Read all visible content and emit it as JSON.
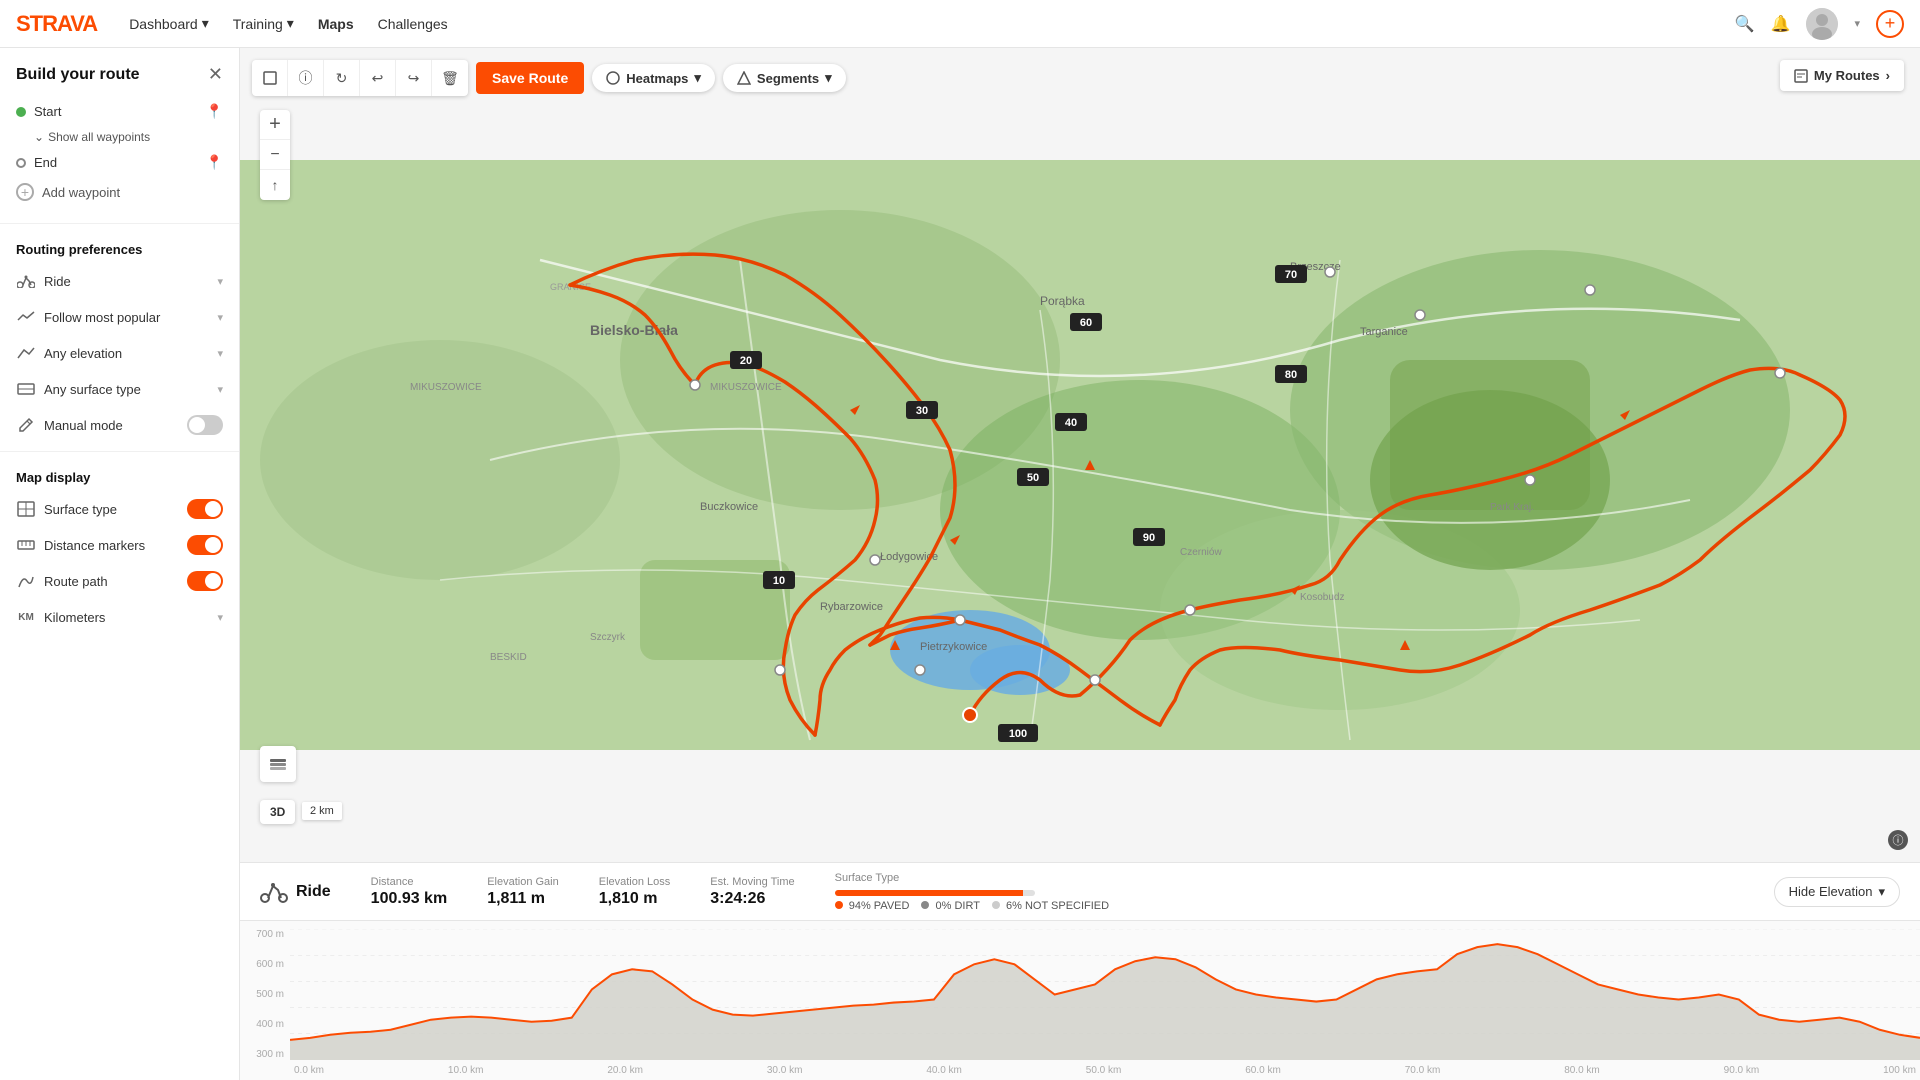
{
  "nav": {
    "logo": "STRAVA",
    "items": [
      {
        "label": "Dashboard",
        "hasChevron": true
      },
      {
        "label": "Training",
        "hasChevron": true
      },
      {
        "label": "Maps",
        "active": true
      },
      {
        "label": "Challenges"
      }
    ],
    "my_routes_label": "My Routes",
    "plus_icon": "+"
  },
  "sidebar": {
    "title": "Build your route",
    "close_icon": "✕",
    "waypoints": {
      "start_label": "Start",
      "show_waypoints_label": "Show all waypoints",
      "end_label": "End",
      "add_waypoint_label": "Add waypoint"
    },
    "routing_preferences": {
      "title": "Routing preferences",
      "items": [
        {
          "label": "Ride",
          "icon": "🚴"
        },
        {
          "label": "Follow most popular",
          "icon": "📈"
        },
        {
          "label": "Any elevation",
          "icon": "📐"
        },
        {
          "label": "Any surface type",
          "icon": "⬜"
        },
        {
          "label": "Manual mode",
          "icon": "✏️",
          "is_toggle": true,
          "toggle_value": false
        }
      ]
    },
    "map_display": {
      "title": "Map display",
      "items": [
        {
          "label": "Surface type",
          "icon": "🗺",
          "toggle_value": true
        },
        {
          "label": "Distance markers",
          "icon": "📏",
          "toggle_value": true
        },
        {
          "label": "Route path",
          "icon": "〰",
          "toggle_value": true
        },
        {
          "label": "Kilometers",
          "icon": "KM",
          "is_select": true
        }
      ]
    }
  },
  "toolbar": {
    "save_route_label": "Save Route",
    "heatmaps_label": "Heatmaps",
    "segments_label": "Segments",
    "my_routes_label": "My Routes"
  },
  "stats": {
    "activity_type": "Ride",
    "distance_label": "Distance",
    "distance_value": "100.93 km",
    "elevation_gain_label": "Elevation Gain",
    "elevation_gain_value": "1,811 m",
    "elevation_loss_label": "Elevation Loss",
    "elevation_loss_value": "1,810 m",
    "moving_time_label": "Est. Moving Time",
    "moving_time_value": "3:24:26",
    "surface_type_label": "Surface Type",
    "surface_paved_label": "94% PAVED",
    "surface_dirt_label": "0% DIRT",
    "surface_notspec_label": "6% NOT SPECIFIED",
    "hide_elevation_label": "Hide Elevation"
  },
  "elevation": {
    "y_labels": [
      "700 m",
      "600 m",
      "500 m",
      "400 m",
      "300 m"
    ],
    "x_labels": [
      "0.0 km",
      "10.0 km",
      "20.0 km",
      "30.0 km",
      "40.0 km",
      "50.0 km",
      "60.0 km",
      "70.0 km",
      "80.0 km",
      "90.0 km",
      "100 km"
    ]
  },
  "map": {
    "scale_label": "2 km",
    "threed_label": "3D"
  }
}
